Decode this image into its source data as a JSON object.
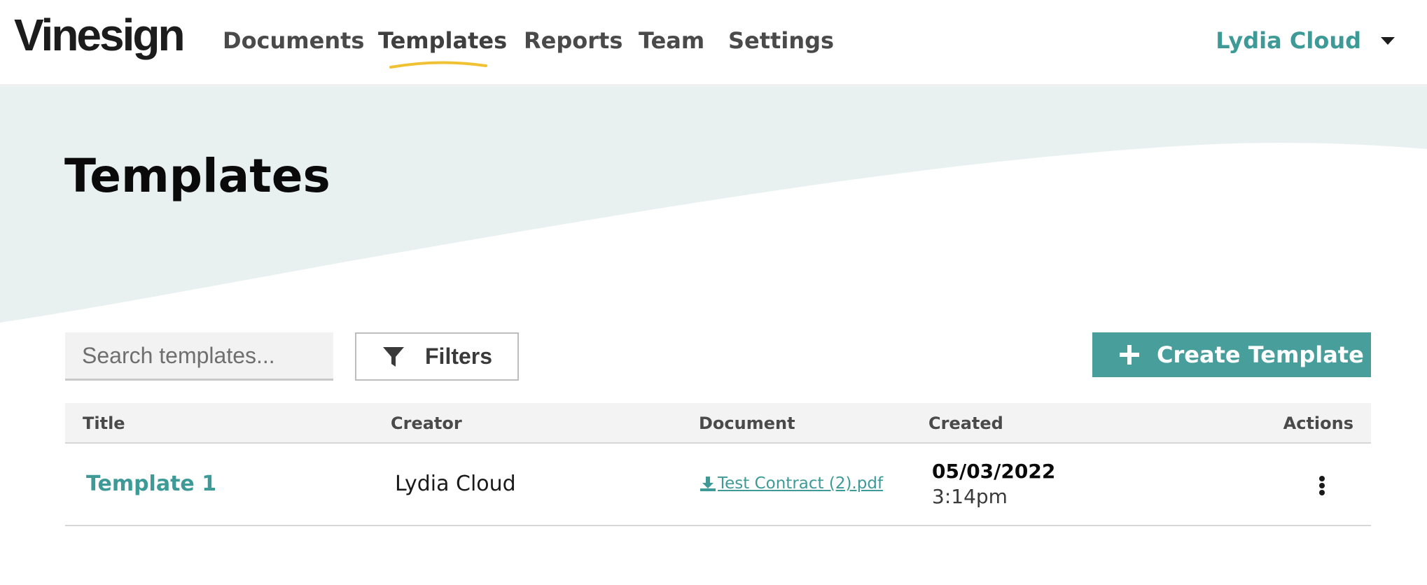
{
  "app": {
    "logo_text": "Vinesign"
  },
  "nav": {
    "items": [
      {
        "label": "Documents"
      },
      {
        "label": "Templates",
        "active": true
      },
      {
        "label": "Reports"
      },
      {
        "label": "Team"
      },
      {
        "label": "Settings"
      }
    ],
    "user_name": "Lydia Cloud"
  },
  "page": {
    "title": "Templates"
  },
  "toolbar": {
    "search_placeholder": "Search templates...",
    "filters_label": "Filters",
    "create_label": "Create Template"
  },
  "table": {
    "columns": {
      "title": "Title",
      "creator": "Creator",
      "document": "Document",
      "created": "Created",
      "actions": "Actions"
    },
    "rows": [
      {
        "title": "Template 1",
        "creator": "Lydia Cloud",
        "document": "Test Contract (2).pdf",
        "created_date": "05/03/2022",
        "created_time": "3:14pm"
      }
    ]
  },
  "colors": {
    "accent": "#489e9b",
    "accent_text": "#3e9a96",
    "hero_bg": "#e9f1f0",
    "underline": "#f0c233"
  },
  "icons": {
    "filter": "funnel-icon",
    "create": "plus-icon",
    "document": "download-icon",
    "actions": "vertical-ellipsis-icon",
    "user_menu": "caret-down-icon"
  }
}
